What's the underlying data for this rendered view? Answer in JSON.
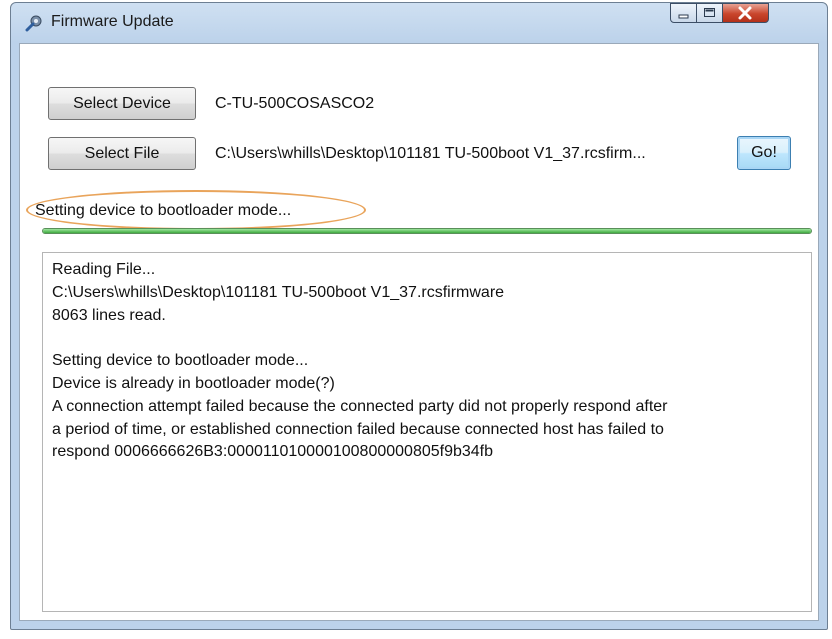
{
  "window": {
    "title": "Firmware Update",
    "icon": "wrench-gear-icon"
  },
  "device": {
    "button_label": "Select Device",
    "value": "C-TU-500COSASCO2"
  },
  "file": {
    "button_label": "Select File",
    "value": "C:\\Users\\whills\\Desktop\\101181 TU-500boot V1_37.rcsfirm..."
  },
  "go": {
    "label": "Go!"
  },
  "status": {
    "text": "Setting device to bootloader mode...",
    "progress": 1.0
  },
  "log": {
    "lines": [
      "Reading File...",
      "C:\\Users\\whills\\Desktop\\101181 TU-500boot V1_37.rcsfirmware",
      "8063 lines read.",
      "",
      "Setting device to bootloader mode...",
      "Device is already in bootloader mode(?)",
      "A connection attempt failed because the connected party did not properly respond after",
      "a period of time, or established connection failed because connected host has failed to",
      "respond 0006666626B3:000011010000100800000805f9b34fb"
    ]
  },
  "colors": {
    "highlight": "#e9a45b",
    "progress": "#3fa93f",
    "close_button": "#c9452c"
  }
}
